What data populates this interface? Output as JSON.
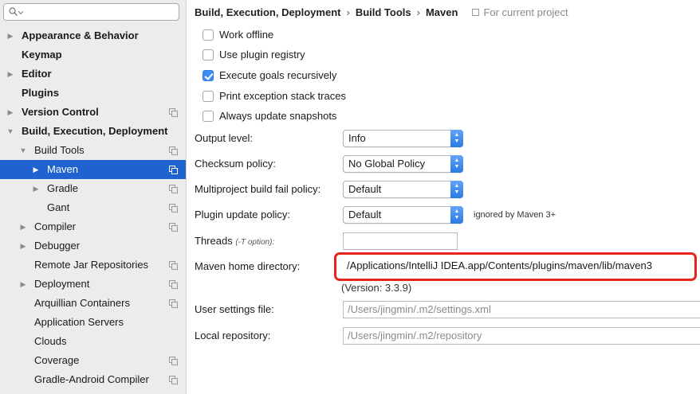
{
  "search": {
    "placeholder": "",
    "icon": "search-icon"
  },
  "sidebar": {
    "items": [
      {
        "label": "Appearance & Behavior",
        "bold": true,
        "arrow": "right",
        "depth": 0
      },
      {
        "label": "Keymap",
        "bold": true,
        "arrow": "none",
        "depth": 0
      },
      {
        "label": "Editor",
        "bold": true,
        "arrow": "right",
        "depth": 0
      },
      {
        "label": "Plugins",
        "bold": true,
        "arrow": "none",
        "depth": 0
      },
      {
        "label": "Version Control",
        "bold": true,
        "arrow": "right",
        "depth": 0,
        "project_icon": true
      },
      {
        "label": "Build, Execution, Deployment",
        "bold": true,
        "arrow": "down",
        "depth": 0
      },
      {
        "label": "Build Tools",
        "bold": false,
        "arrow": "down",
        "depth": 1,
        "project_icon": true
      },
      {
        "label": "Maven",
        "bold": false,
        "arrow": "right",
        "depth": 2,
        "project_icon": true,
        "selected": true
      },
      {
        "label": "Gradle",
        "bold": false,
        "arrow": "right",
        "depth": 2,
        "project_icon": true
      },
      {
        "label": "Gant",
        "bold": false,
        "arrow": "none",
        "depth": 2,
        "project_icon": true
      },
      {
        "label": "Compiler",
        "bold": false,
        "arrow": "right",
        "depth": 1,
        "project_icon": true
      },
      {
        "label": "Debugger",
        "bold": false,
        "arrow": "right",
        "depth": 1
      },
      {
        "label": "Remote Jar Repositories",
        "bold": false,
        "arrow": "none",
        "depth": 1,
        "project_icon": true
      },
      {
        "label": "Deployment",
        "bold": false,
        "arrow": "right",
        "depth": 1,
        "project_icon": true
      },
      {
        "label": "Arquillian Containers",
        "bold": false,
        "arrow": "none",
        "depth": 1,
        "project_icon": true
      },
      {
        "label": "Application Servers",
        "bold": false,
        "arrow": "none",
        "depth": 1
      },
      {
        "label": "Clouds",
        "bold": false,
        "arrow": "none",
        "depth": 1
      },
      {
        "label": "Coverage",
        "bold": false,
        "arrow": "none",
        "depth": 1,
        "project_icon": true
      },
      {
        "label": "Gradle-Android Compiler",
        "bold": false,
        "arrow": "none",
        "depth": 1,
        "project_icon": true
      }
    ]
  },
  "breadcrumb": {
    "items": [
      "Build, Execution, Deployment",
      "Build Tools",
      "Maven"
    ],
    "separator": "›",
    "project_note": "For current project"
  },
  "options": {
    "work_offline": {
      "label": "Work offline",
      "checked": false
    },
    "use_plugin_registry": {
      "label": "Use plugin registry",
      "checked": false
    },
    "execute_goals_recursively": {
      "label": "Execute goals recursively",
      "checked": true
    },
    "print_exception_stack_traces": {
      "label": "Print exception stack traces",
      "checked": false
    },
    "always_update_snapshots": {
      "label": "Always update snapshots",
      "checked": false
    }
  },
  "fields": {
    "output_level": {
      "label": "Output level:",
      "value": "Info"
    },
    "checksum_policy": {
      "label": "Checksum policy:",
      "value": "No Global Policy"
    },
    "multiproject_fail_policy": {
      "label": "Multiproject build fail policy:",
      "value": "Default"
    },
    "plugin_update_policy": {
      "label": "Plugin update policy:",
      "value": "Default",
      "note": "ignored by Maven 3+"
    },
    "threads": {
      "label": "Threads",
      "hint": "(-T option):",
      "value": ""
    },
    "maven_home": {
      "label": "Maven home directory:",
      "value": "/Applications/IntelliJ IDEA.app/Contents/plugins/maven/lib/maven3",
      "version": "(Version: 3.3.9)"
    },
    "user_settings": {
      "label": "User settings file:",
      "value": "/Users/jingmin/.m2/settings.xml"
    },
    "local_repository": {
      "label": "Local repository:",
      "value": "/Users/jingmin/.m2/repository"
    }
  },
  "colors": {
    "selection": "#1f62d0",
    "checkbox_checked": "#3d8ef2",
    "highlight": "#e8251d",
    "sidebar_bg": "#ececec"
  },
  "select_arrows": "⌃⌄"
}
